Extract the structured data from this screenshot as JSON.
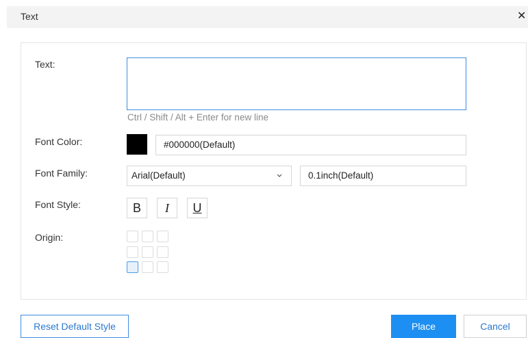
{
  "dialog": {
    "title": "Text",
    "close_symbol": "✕"
  },
  "form": {
    "text_label": "Text:",
    "text_value": "",
    "text_hint": "Ctrl / Shift / Alt + Enter for new line",
    "font_color_label": "Font Color:",
    "font_color_swatch": "#000000",
    "font_color_value": "#000000(Default)",
    "font_family_label": "Font Family:",
    "font_family_value": "Arial(Default)",
    "font_size_value": "0.1inch(Default)",
    "font_style_label": "Font Style:",
    "bold_label": "B",
    "italic_label": "I",
    "underline_label": "U",
    "origin_label": "Origin:",
    "origin_selected": "bottom-left"
  },
  "footer": {
    "reset_label": "Reset Default Style",
    "place_label": "Place",
    "cancel_label": "Cancel"
  },
  "colors": {
    "accent": "#1d8ff2",
    "border": "#d6d6d6",
    "hint": "#8a8a8a"
  }
}
